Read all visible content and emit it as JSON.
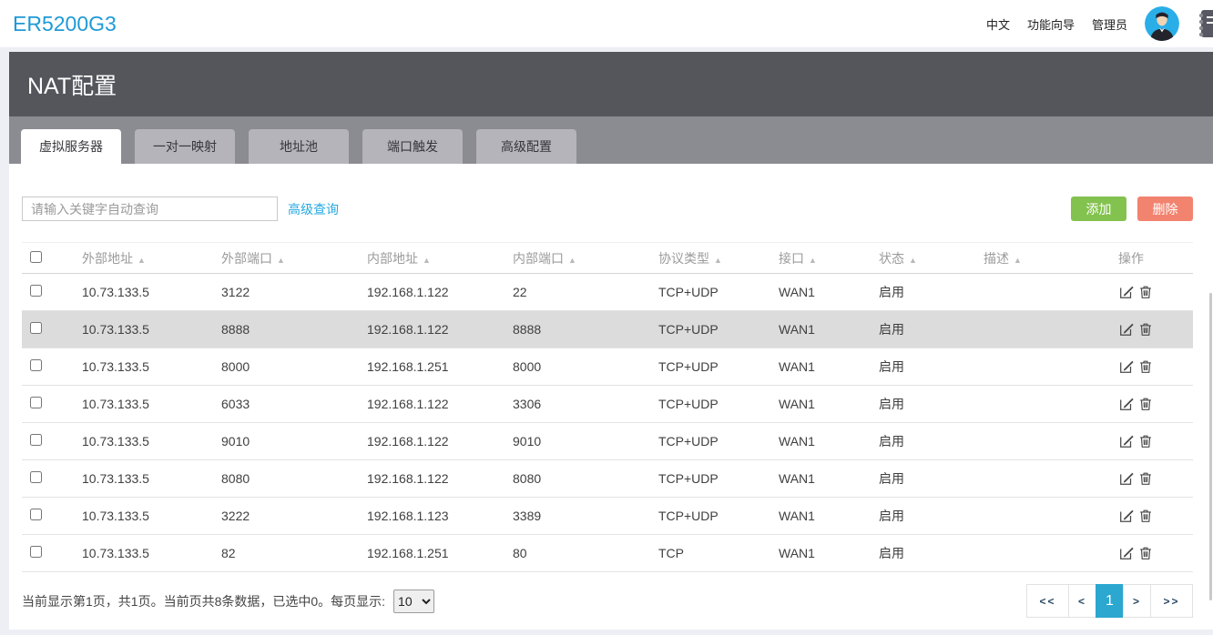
{
  "header": {
    "logo": "ER5200G3",
    "menu": [
      {
        "label": "中文"
      },
      {
        "label": "功能向导"
      },
      {
        "label": "管理员"
      }
    ]
  },
  "page": {
    "title": "NAT配置"
  },
  "tabs": [
    {
      "label": "虚拟服务器",
      "active": true
    },
    {
      "label": "一对一映射",
      "active": false
    },
    {
      "label": "地址池",
      "active": false
    },
    {
      "label": "端口触发",
      "active": false
    },
    {
      "label": "高级配置",
      "active": false
    }
  ],
  "toolbar": {
    "search_placeholder": "请输入关键字自动查询",
    "advanced_search_label": "高级查询",
    "add_label": "添加",
    "delete_label": "删除"
  },
  "table": {
    "columns": [
      "外部地址",
      "外部端口",
      "内部地址",
      "内部端口",
      "协议类型",
      "接口",
      "状态",
      "描述",
      "操作"
    ],
    "sort_icon": "▲",
    "rows": [
      {
        "external_ip": "10.73.133.5",
        "external_port": "3122",
        "internal_ip": "192.168.1.122",
        "internal_port": "22",
        "protocol": "TCP+UDP",
        "interface": "WAN1",
        "status": "启用",
        "description": ""
      },
      {
        "external_ip": "10.73.133.5",
        "external_port": "8888",
        "internal_ip": "192.168.1.122",
        "internal_port": "8888",
        "protocol": "TCP+UDP",
        "interface": "WAN1",
        "status": "启用",
        "description": ""
      },
      {
        "external_ip": "10.73.133.5",
        "external_port": "8000",
        "internal_ip": "192.168.1.251",
        "internal_port": "8000",
        "protocol": "TCP+UDP",
        "interface": "WAN1",
        "status": "启用",
        "description": ""
      },
      {
        "external_ip": "10.73.133.5",
        "external_port": "6033",
        "internal_ip": "192.168.1.122",
        "internal_port": "3306",
        "protocol": "TCP+UDP",
        "interface": "WAN1",
        "status": "启用",
        "description": ""
      },
      {
        "external_ip": "10.73.133.5",
        "external_port": "9010",
        "internal_ip": "192.168.1.122",
        "internal_port": "9010",
        "protocol": "TCP+UDP",
        "interface": "WAN1",
        "status": "启用",
        "description": ""
      },
      {
        "external_ip": "10.73.133.5",
        "external_port": "8080",
        "internal_ip": "192.168.1.122",
        "internal_port": "8080",
        "protocol": "TCP+UDP",
        "interface": "WAN1",
        "status": "启用",
        "description": ""
      },
      {
        "external_ip": "10.73.133.5",
        "external_port": "3222",
        "internal_ip": "192.168.1.123",
        "internal_port": "3389",
        "protocol": "TCP+UDP",
        "interface": "WAN1",
        "status": "启用",
        "description": ""
      },
      {
        "external_ip": "10.73.133.5",
        "external_port": "82",
        "internal_ip": "192.168.1.251",
        "internal_port": "80",
        "protocol": "TCP",
        "interface": "WAN1",
        "status": "启用",
        "description": ""
      }
    ]
  },
  "pagination": {
    "summary": "当前显示第1页，共1页。当前页共8条数据，已选中0。每页显示:",
    "page_size": "10",
    "first_label": "<<",
    "prev_label": "<",
    "current_page": "1",
    "next_label": ">",
    "last_label": ">>"
  },
  "colors": {
    "logo_blue": "#1f9ad6",
    "banner_gray": "#54565c",
    "tabstrip_gray": "#8b8b92",
    "link_blue": "#26a9e0",
    "add_green": "#84c24f",
    "delete_red": "#f2836f",
    "active_page_blue": "#2ba7d0",
    "row_highlight": "#dcdcdc"
  }
}
